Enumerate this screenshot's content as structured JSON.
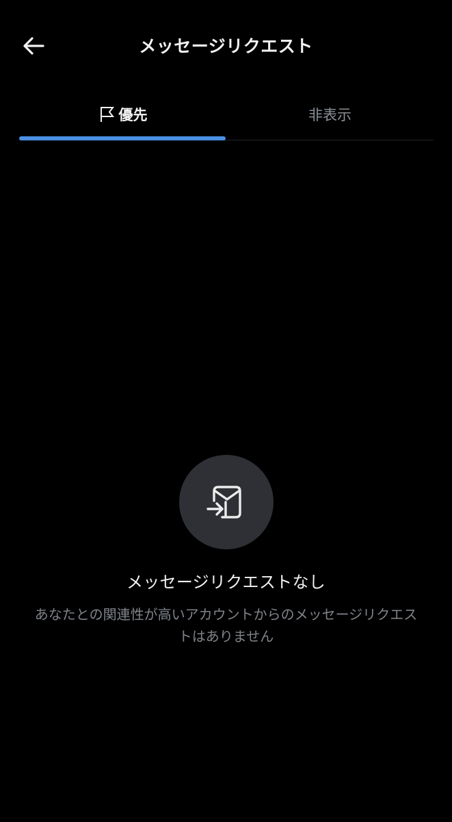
{
  "header": {
    "title": "メッセージリクエスト",
    "back_icon": "arrow-left-icon"
  },
  "tabs": [
    {
      "label": "優先",
      "icon": "flag-icon",
      "active": true
    },
    {
      "label": "非表示",
      "active": false
    }
  ],
  "empty_state": {
    "icon": "inbox-arrow-icon",
    "title": "メッセージリクエストなし",
    "description": "あなたとの関連性が高いアカウントからのメッセージリクエストはありません"
  },
  "colors": {
    "background": "#000000",
    "accent": "#4a90e2",
    "text_primary": "#f2f2f2",
    "text_secondary": "#7f848a",
    "icon_circle": "#2e3035"
  }
}
